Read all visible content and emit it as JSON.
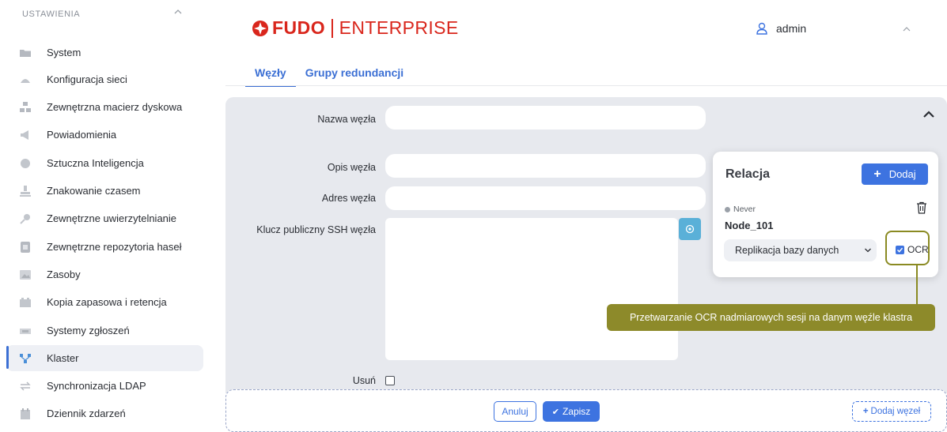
{
  "sidebar": {
    "header": "USTAWIENIA",
    "items": [
      {
        "label": "System",
        "icon": "folder-icon"
      },
      {
        "label": "Konfiguracja sieci",
        "icon": "network-icon"
      },
      {
        "label": "Zewnętrzna macierz dyskowa",
        "icon": "disk-array-icon"
      },
      {
        "label": "Powiadomienia",
        "icon": "megaphone-icon"
      },
      {
        "label": "Sztuczna Inteligencja",
        "icon": "brain-icon"
      },
      {
        "label": "Znakowanie czasem",
        "icon": "stamp-icon"
      },
      {
        "label": "Zewnętrzne uwierzytelnianie",
        "icon": "key-icon"
      },
      {
        "label": "Zewnętrzne repozytoria haseł",
        "icon": "vault-icon"
      },
      {
        "label": "Zasoby",
        "icon": "image-icon"
      },
      {
        "label": "Kopia zapasowa i retencja",
        "icon": "archive-icon"
      },
      {
        "label": "Systemy zgłoszeń",
        "icon": "ticket-icon"
      },
      {
        "label": "Klaster",
        "icon": "cluster-icon",
        "active": true
      },
      {
        "label": "Synchronizacja LDAP",
        "icon": "sync-icon"
      },
      {
        "label": "Dziennik zdarzeń",
        "icon": "calendar-icon"
      }
    ]
  },
  "header": {
    "logo_brand": "FUDO",
    "logo_edition": "ENTERPRISE",
    "user": "admin"
  },
  "tabs": [
    {
      "label": "Węzły",
      "active": true
    },
    {
      "label": "Grupy redundancji",
      "active": false
    }
  ],
  "form": {
    "node_name_label": "Nazwa węzła",
    "node_name_value": "",
    "node_desc_label": "Opis węzła",
    "node_desc_value": "",
    "node_addr_label": "Adres węzła",
    "node_addr_value": "",
    "ssh_key_label": "Klucz publiczny SSH węzła",
    "ssh_key_value": "",
    "delete_label": "Usuń",
    "delete_checked": false
  },
  "relation": {
    "title": "Relacja",
    "add_label": "Dodaj",
    "status": "Never",
    "node": "Node_101",
    "select_value": "Replikacja bazy danych",
    "ocr_label": "OCR",
    "ocr_checked": true
  },
  "tooltip": "Przetwarzanie OCR nadmiarowych sesji na danym węźle klastra",
  "actions": {
    "cancel": "Anuluj",
    "save": "Zapisz",
    "add_node": "Dodaj węzeł"
  },
  "colors": {
    "brand": "#d9261c",
    "accent": "#3d73e0",
    "tooltip": "#8d8a2a"
  }
}
